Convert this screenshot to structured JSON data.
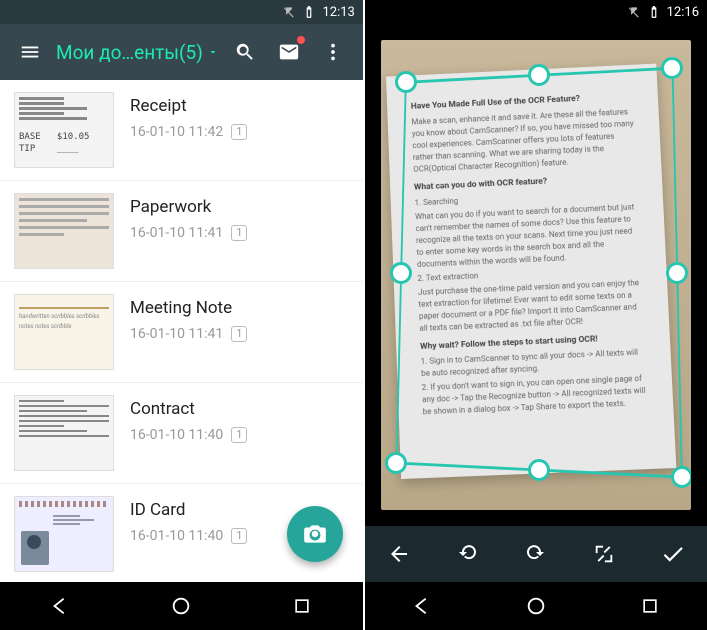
{
  "left": {
    "status_time": "12:13",
    "app_title": "Мои до…енты(5)",
    "documents": [
      {
        "title": "Receipt",
        "date": "16-01-10 11:42",
        "pages": "1"
      },
      {
        "title": "Paperwork",
        "date": "16-01-10 11:41",
        "pages": "1"
      },
      {
        "title": "Meeting Note",
        "date": "16-01-10 11:41",
        "pages": "1"
      },
      {
        "title": "Contract",
        "date": "16-01-10 11:40",
        "pages": "1"
      },
      {
        "title": "ID Card",
        "date": "16-01-10 11:40",
        "pages": "1"
      }
    ]
  },
  "right": {
    "status_time": "12:16",
    "paper": {
      "h1": "Have You Made Full Use of the OCR Feature?",
      "p1": "Make a scan, enhance it and save it. Are these all the features you know about CamScanner? If so, you have missed too many cool experiences. CamScanner offers you lots of features rather than scanning. What we are sharing today is the OCR(Optical Character Recognition) feature.",
      "h2": "What can you do with OCR feature?",
      "p2a": "1. Searching",
      "p2b": "What can you do if you want to search for a document but just can't remember the names of some docs? Use this feature to recognize all the texts on your scans. Next time you just need to enter some key words in the search box and all the documents within the words will be found.",
      "p2c": "2. Text extraction",
      "p2d": "Just purchase the one-time paid version and you can enjoy the text extraction for lifetime! Ever want to edit some texts on a paper document or a PDF file? Import it into CamScanner and all texts can be extracted as .txt file after OCR!",
      "h3": "Why wait? Follow the steps to start using OCR!",
      "p3a": "1. Sign in to CamScanner to sync all your docs -> All texts will be auto recognized after syncing.",
      "p3b": "2. If you don't want to sign in, you can open one single page of any doc -> Tap the Recognize button -> All recognized texts will be shown in a dialog box -> Tap Share to export the texts."
    }
  }
}
